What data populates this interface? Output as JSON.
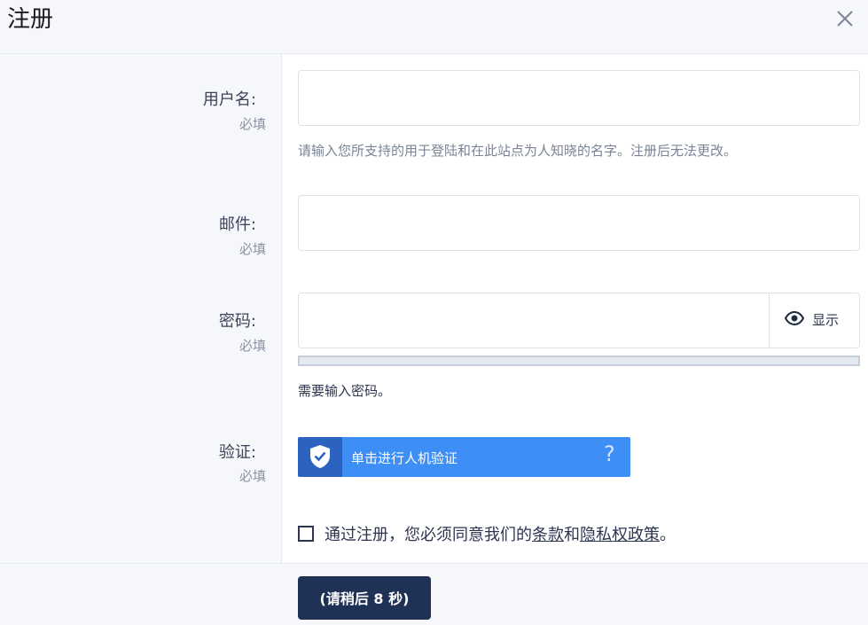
{
  "dialog": {
    "title": "注册"
  },
  "fields": {
    "username": {
      "label": "用户名:",
      "required": "必填",
      "value": "",
      "hint": "请输入您所支持的用于登陆和在此站点为人知晓的名字。注册后无法更改。"
    },
    "email": {
      "label": "邮件:",
      "required": "必填",
      "value": ""
    },
    "password": {
      "label": "密码:",
      "required": "必填",
      "value": "",
      "show_label": "显示",
      "status": "需要输入密码。"
    },
    "verify": {
      "label": "验证:",
      "required": "必填",
      "captcha_text": "单击进行人机验证",
      "help": "?"
    }
  },
  "terms": {
    "prefix": "通过注册，您必须同意我们的",
    "terms_link": "条款",
    "and": "和",
    "privacy_link": "隐私权政策",
    "suffix": "。"
  },
  "footer": {
    "submit_label": "(请稍后 8 秒)"
  },
  "colors": {
    "accent": "#3d8ef5",
    "captcha_dark": "#2c63c0",
    "primary_button": "#1f3155"
  }
}
